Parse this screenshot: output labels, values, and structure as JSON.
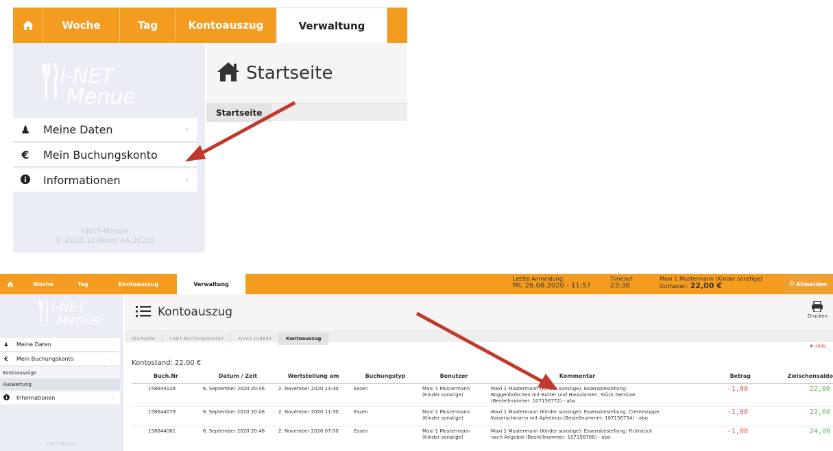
{
  "colors": {
    "nav": "#f39c1f",
    "sidebar": "#eaedf3",
    "arrow": "#c0392b",
    "negative": "#d9534f",
    "positive": "#5cb85c"
  },
  "top": {
    "nav": [
      "home-icon",
      "Woche",
      "Tag",
      "Kontoauszug",
      "Verwaltung"
    ],
    "brand": [
      "i-NET",
      "Menue"
    ],
    "menu": [
      {
        "icon": "user-icon",
        "label": "Meine Daten"
      },
      {
        "icon": "euro-icon",
        "label": "Mein Buchungskonto"
      },
      {
        "icon": "info-icon",
        "label": "Informationen"
      }
    ],
    "version": [
      "i-NET-Menue",
      "V. 2020.10(Build 64.2020)"
    ],
    "page_title": "Startseite",
    "breadcrumb": "Startseite"
  },
  "bottom": {
    "nav": [
      "home-icon",
      "Woche",
      "Tag",
      "Kontoauszug",
      "Verwaltung"
    ],
    "last_login_label": "Letzte Anmeldung",
    "last_login_value": "Mi, 26.08.2020 - 11:57",
    "timeout_label": "Timeout",
    "timeout_value": "23:38",
    "user_label": "Maxi 1 Mustermann (Kinder sonstige)",
    "credit_label": "Guthaben:",
    "credit_value": "22,00 €",
    "logout": "Abmelden",
    "brand": [
      "i-NET",
      "Menue"
    ],
    "menu": [
      {
        "icon": "user-icon",
        "label": "Meine Daten"
      },
      {
        "icon": "euro-icon",
        "label": "Mein Buchungskonto"
      },
      {
        "icon": "info-icon",
        "label": "Informationen"
      }
    ],
    "submenu": [
      "Kontoauszüge",
      "Auswertung"
    ],
    "version": "i-NET-Menue",
    "page_title": "Kontoauszug",
    "print_label": "Drucken",
    "help_label": "Hilfe",
    "breadcrumbs": [
      "Startseite",
      "i-NET Buchungskonten",
      "Konto 108655",
      "Kontoauszug"
    ],
    "balance": "Kontostand: 22,00 €",
    "columns": [
      "Buch.Nr",
      "Datum / Zeit",
      "Wertstellung am",
      "Buchungstyp",
      "Benutzer",
      "Kommentar",
      "Betrag",
      "Zwischensaldo"
    ],
    "rows": [
      {
        "nr": "158644128",
        "date": "6. September 2020 20:46",
        "value_date": "2. November 2020 14:30",
        "type": "Essen",
        "user": "Maxi 1 Mustermann (Kinder sonstige)",
        "comment": "Maxi 1 Mustermann (Kinder sonstige): Essensbestellung: Roggenbrötchen mit Butter und Hausdamen, Stück Gemüse (Bestellnummer: 107156772) - abo",
        "amount": "-1,00",
        "saldo": "22,00"
      },
      {
        "nr": "158644079",
        "date": "6. September 2020 20:46",
        "value_date": "2. November 2020 11:30",
        "type": "Essen",
        "user": "Maxi 1 Mustermann (Kinder sonstige)",
        "comment": "Maxi 1 Mustermann (Kinder sonstige): Essensbestellung: Cremesuppe, Kaiserschmarrn mit Apfelmus (Bestellnummer: 107156754) - abo",
        "amount": "-1,00",
        "saldo": "23,00"
      },
      {
        "nr": "158644061",
        "date": "6. September 2020 20:46",
        "value_date": "2. November 2020 07:00",
        "type": "Essen",
        "user": "Maxi 1 Mustermann (Kinder sonstige)",
        "comment": "Maxi 1 Mustermann (Kinder sonstige): Essensbestellung: Frühstück nach Angebot (Bestellnummer: 107156708) - abo",
        "amount": "-1,00",
        "saldo": "24,00"
      }
    ]
  }
}
